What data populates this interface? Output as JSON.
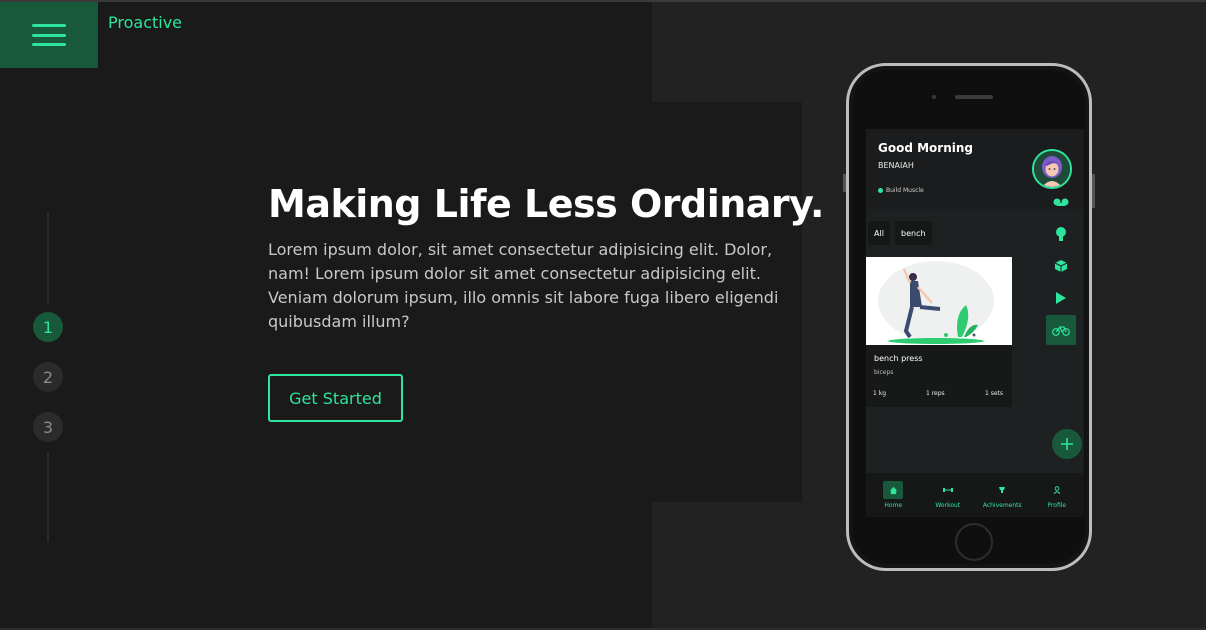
{
  "brand": "Proactive",
  "hero": {
    "title": "Making Life Less Ordinary.",
    "description": "Lorem ipsum dolor, sit amet consectetur adipisicing elit. Dolor, nam! Lorem ipsum dolor sit amet consectetur adipisicing elit. Veniam dolorum ipsum, illo omnis sit labore fuga libero eligendi quibusdam illum?",
    "cta": "Get Started"
  },
  "steps": [
    {
      "label": "1",
      "active": true
    },
    {
      "label": "2",
      "active": false
    },
    {
      "label": "3",
      "active": false
    }
  ],
  "app": {
    "greeting": "Good Morning",
    "user": "BENAIAH",
    "goal": "Build Muscle",
    "filters": [
      "All",
      "bench"
    ],
    "card": {
      "title": "bench press",
      "subtitle": "biceps",
      "weight": "1 kg",
      "reps": "1 reps",
      "sets": "1 sets"
    },
    "side_icons": [
      "tape-icon",
      "lightbulb-icon",
      "cube-icon",
      "play-icon",
      "bicycle-icon"
    ],
    "nav": [
      {
        "label": "Home",
        "icon": "home-icon",
        "active": true
      },
      {
        "label": "Workout",
        "icon": "dumbbell-icon",
        "active": false
      },
      {
        "label": "Achivements",
        "icon": "trophy-icon",
        "active": false
      },
      {
        "label": "Profile",
        "icon": "user-icon",
        "active": false
      }
    ]
  },
  "colors": {
    "accent": "#2ee59d",
    "accent_dark": "#17593a",
    "background": "#1a1a1a",
    "panel": "#222222"
  }
}
